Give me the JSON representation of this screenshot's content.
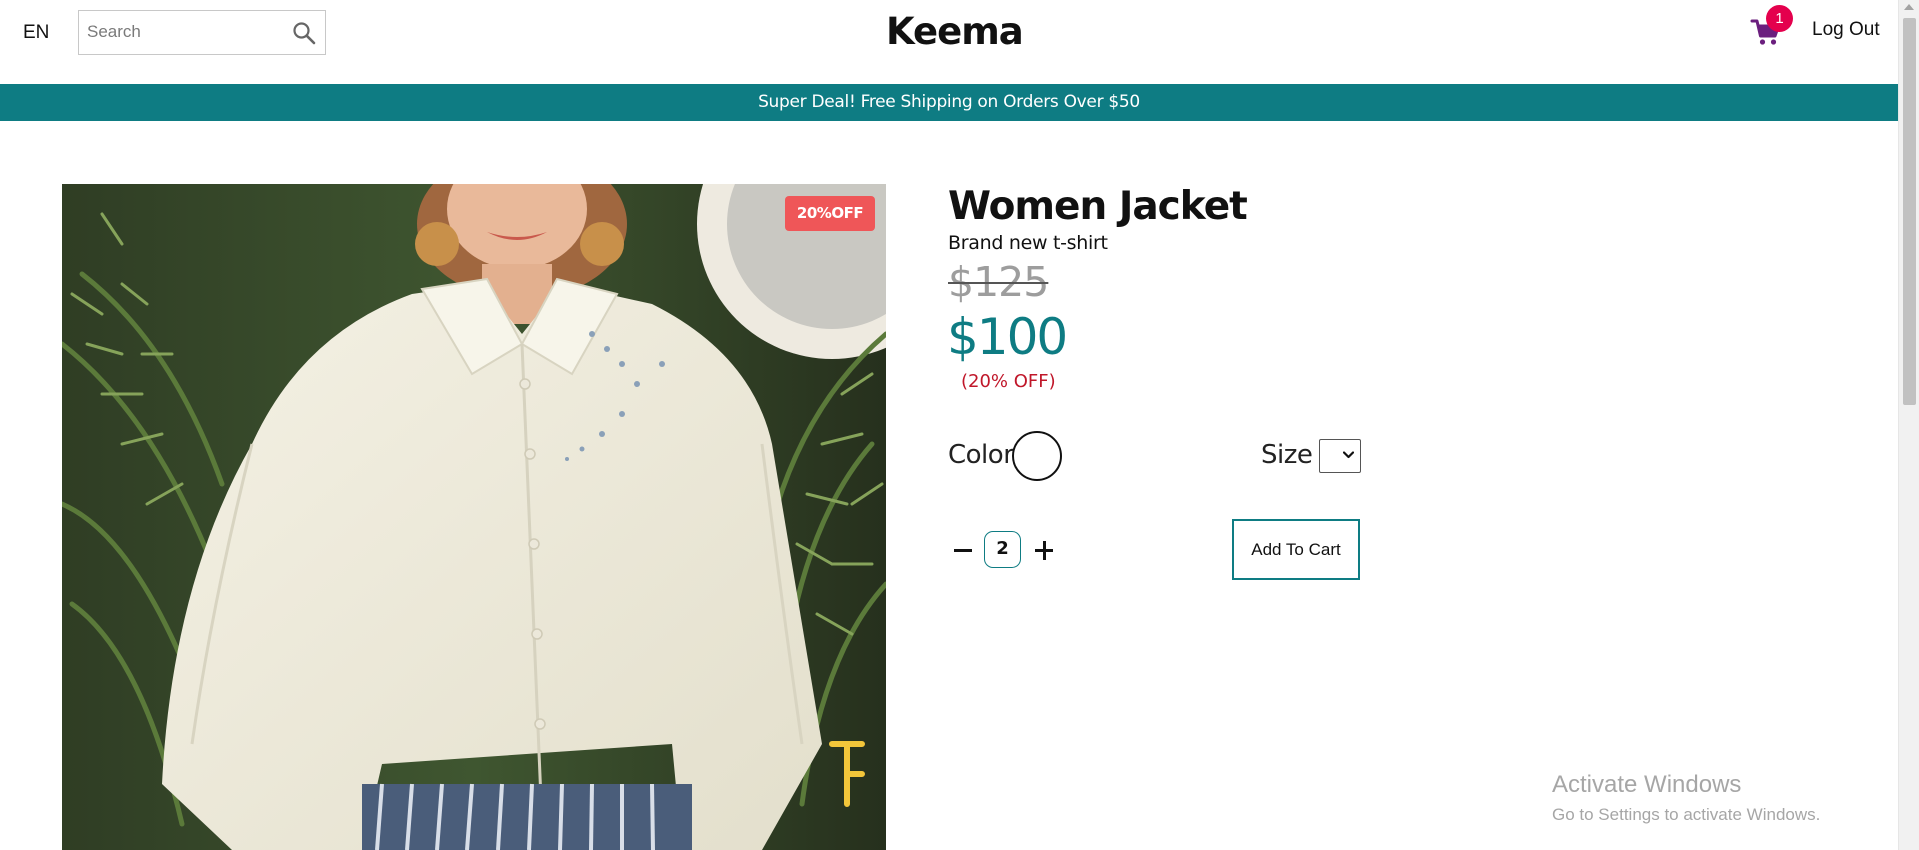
{
  "header": {
    "language": "EN",
    "search_placeholder": "Search",
    "logo": "Keema",
    "cart_count": "1",
    "logout": "Log Out"
  },
  "banner": {
    "text": "Super Deal! Free Shipping on Orders Over $50"
  },
  "product": {
    "discount_badge": "20%OFF",
    "title": "Women Jacket",
    "subtitle": "Brand new t-shirt",
    "old_price": "$125",
    "new_price": "$100",
    "off_label": "(20% OFF)",
    "color_label": "Color",
    "size_label": "Size",
    "quantity": "2",
    "add_to_cart": "Add To Cart"
  },
  "watermark": {
    "title": "Activate Windows",
    "subtitle": "Go to Settings to activate Windows."
  },
  "colors": {
    "accent": "#0e7c83",
    "badge": "#ef5658",
    "cart_badge": "#e4004d",
    "off_text": "#c0172a"
  },
  "icons": {
    "search": "search-icon",
    "cart": "cart-icon",
    "size_dropdown": "chevron-down-icon"
  }
}
